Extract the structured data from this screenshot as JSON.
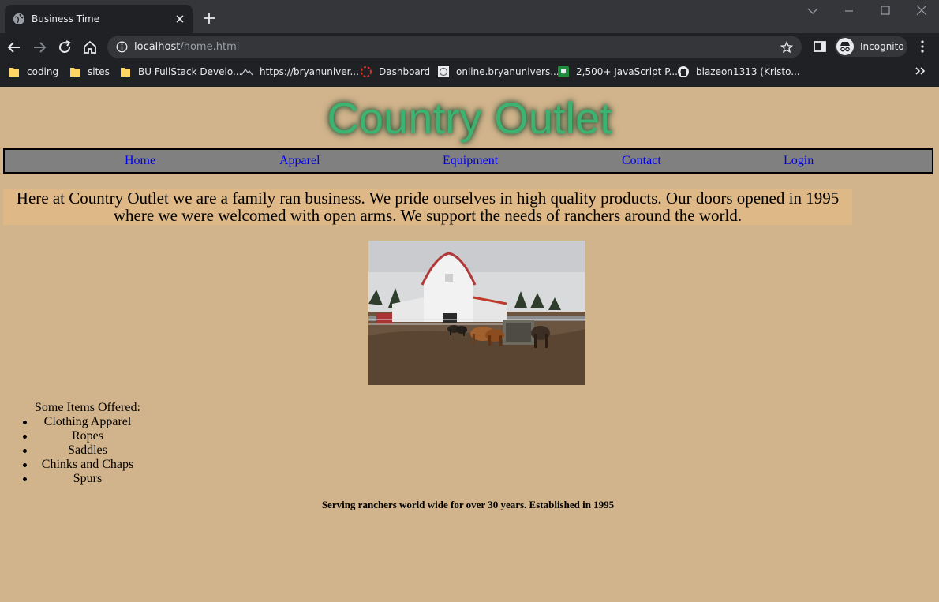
{
  "browser": {
    "tab_title": "Business Time",
    "url_host": "localhost",
    "url_path": "/home.html",
    "profile_label": "Incognito",
    "bookmarks": [
      {
        "label": "coding",
        "icon": "folder-icon"
      },
      {
        "label": "sites",
        "icon": "folder-icon"
      },
      {
        "label": "BU FullStack Develo...",
        "icon": "folder-icon"
      },
      {
        "label": "https://bryanuniver...",
        "icon": "mountain-icon"
      },
      {
        "label": "Dashboard",
        "icon": "dashboard-icon"
      },
      {
        "label": "online.bryanunivers...",
        "icon": "seal-icon"
      },
      {
        "label": "2,500+ JavaScript P...",
        "icon": "shield-icon"
      },
      {
        "label": "blazeon1313 (Kristo...",
        "icon": "github-icon"
      }
    ]
  },
  "site": {
    "title": "Country Outlet",
    "nav": [
      "Home",
      "Apparel",
      "Equipment",
      "Contact",
      "Login"
    ],
    "intro": "Here at Country Outlet we are a family ran business. We pride ourselves in high quality products. Our doors opened in 1995 where we were welcomed with open arms. We support the needs of ranchers around the world.",
    "items_heading": "Some Items Offered:",
    "items": [
      "Clothing Apparel",
      "Ropes",
      "Saddles",
      "Chinks and Chaps",
      "Spurs"
    ],
    "footer": "Serving ranchers world wide for over 30 years. Established in 1995"
  },
  "colors": {
    "page_background": "#d2b48c",
    "title_green": "#3cb371",
    "nav_background": "#808080",
    "intro_background": "#deb887",
    "link": "#0000ee"
  }
}
